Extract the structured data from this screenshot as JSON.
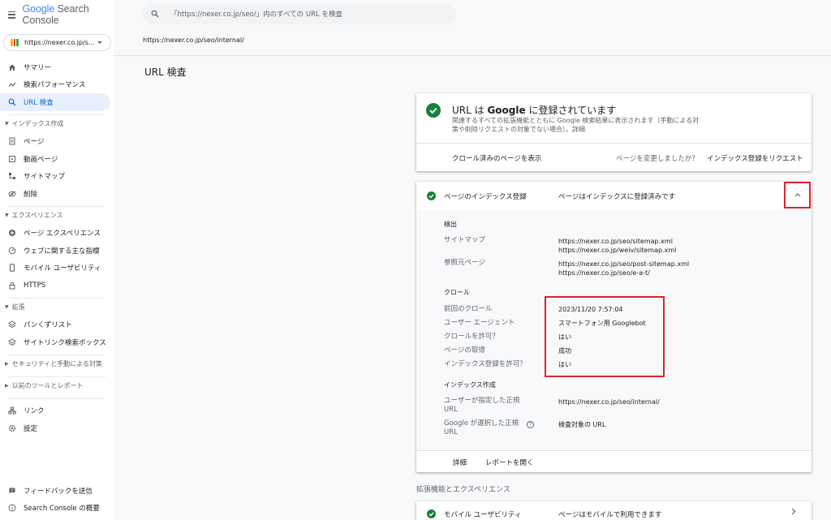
{
  "app": {
    "logo_google": "Google",
    "logo_product": " Search Console"
  },
  "property": {
    "label": "https://nexer.co.jp/s..."
  },
  "search": {
    "placeholder": "「https://nexer.co.jp/seo/」内のすべての URL を検査"
  },
  "sidebar": {
    "items_top": [
      {
        "label": "サマリー",
        "icon": "home-icon"
      },
      {
        "label": "検索パフォーマンス",
        "icon": "trending-icon"
      },
      {
        "label": "URL 検査",
        "icon": "search-icon",
        "active": true
      }
    ],
    "section_index": "インデックス作成",
    "items_index": [
      {
        "label": "ページ",
        "icon": "file-icon"
      },
      {
        "label": "動画ページ",
        "icon": "video-icon"
      },
      {
        "label": "サイトマップ",
        "icon": "sitemap-icon"
      },
      {
        "label": "削除",
        "icon": "remove-icon"
      }
    ],
    "section_experience": "エクスペリエンス",
    "items_experience": [
      {
        "label": "ページ エクスペリエンス",
        "icon": "plus-circle-icon"
      },
      {
        "label": "ウェブに関する主な指標",
        "icon": "gauge-icon"
      },
      {
        "label": "モバイル ユーザビリティ",
        "icon": "phone-icon"
      },
      {
        "label": "HTTPS",
        "icon": "lock-icon"
      }
    ],
    "section_enhance": "拡張",
    "items_enhance": [
      {
        "label": "パンくずリスト",
        "icon": "layers-icon"
      },
      {
        "label": "サイトリンク検索ボックス",
        "icon": "layers-icon"
      }
    ],
    "section_security": "セキュリティと手動による対策",
    "section_legacy": "以前のツールとレポート",
    "items_bottom": [
      {
        "label": "リンク",
        "icon": "links-icon"
      },
      {
        "label": "設定",
        "icon": "gear-icon"
      }
    ],
    "feedback": "フィードバックを送信",
    "about": "Search Console の概要"
  },
  "main": {
    "url": "https://nexer.co.jp/seo/internal/",
    "page_title": "URL 検査"
  },
  "status_card": {
    "title_pre": "URL は ",
    "title_bold": "Google",
    "title_post": " に登録されています",
    "desc": "関連するすべての拡張機能とともに Google 検索結果に表示されます（手動による対策や削除リクエストの対象でない場合）。詳細",
    "action_view": "クロール済みのページを表示",
    "question": "ページを変更しましたか？",
    "action_request": "インデックス登録をリクエスト"
  },
  "index_card": {
    "title": "ページのインデックス登録",
    "status": "ページはインデックスに登録済みです",
    "section_discovery": "検出",
    "sitemap_label": "サイトマップ",
    "sitemaps": [
      "https://nexer.co.jp/seo/sitemap.xml",
      "https://nexer.co.jp/weiv/sitemap.xml"
    ],
    "referrer_label": "参照元ページ",
    "referrers": [
      "https://nexer.co.jp/seo/post-sitemap.xml",
      "https://nexer.co.jp/seo/e-a-t/"
    ],
    "section_crawl": "クロール",
    "crawl": [
      {
        "label": "前回のクロール",
        "value": "2023/11/20 7:57:04"
      },
      {
        "label": "ユーザー エージェント",
        "value": "スマートフォン用 Googlebot"
      },
      {
        "label": "クロールを許可？",
        "value": "はい"
      },
      {
        "label": "ページの取得",
        "value": "成功"
      },
      {
        "label": "インデックス登録を許可？",
        "value": "はい"
      }
    ],
    "section_indexing": "インデックス作成",
    "user_canonical_label_1": "ユーザーが指定した正規",
    "user_canonical_label_2": "URL",
    "user_canonical_value": "https://nexer.co.jp/seo/internal/",
    "google_canonical_label_1": "Google が選択した正規",
    "google_canonical_label_2": "URL",
    "google_canonical_value": "検査対象の URL",
    "help_glyph": "?",
    "footer_details": "詳細",
    "footer_report": "レポートを開く"
  },
  "enhancements": {
    "title": "拡張機能とエクスペリエンス",
    "mobile_title": "モバイル ユーザビリティ",
    "mobile_status": "ページはモバイルで利用できます"
  },
  "colors": {
    "accent": "#1967d2",
    "success": "#188038",
    "highlight": "#d9262f"
  }
}
